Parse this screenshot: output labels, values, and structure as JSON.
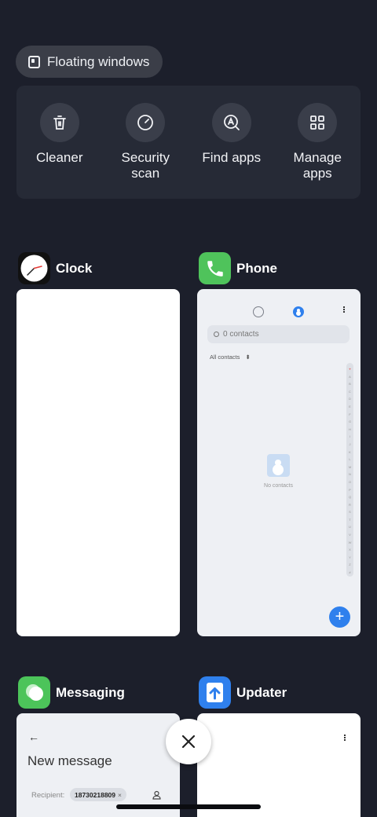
{
  "floating": {
    "label": "Floating windows",
    "icon": "floating-window-icon"
  },
  "tools": [
    {
      "label": "Cleaner",
      "icon": "trash-icon"
    },
    {
      "label": "Security scan",
      "icon": "speedometer-icon"
    },
    {
      "label": "Find apps",
      "icon": "search-apps-icon"
    },
    {
      "label": "Manage apps",
      "icon": "grid-icon"
    }
  ],
  "apps": {
    "clock": {
      "name": "Clock"
    },
    "phone": {
      "name": "Phone",
      "search_placeholder": "0 contacts",
      "filter_label": "All contacts",
      "empty_text": "No contacts",
      "index_letters": [
        "♥",
        "A",
        "B",
        "C",
        "D",
        "E",
        "F",
        "G",
        "H",
        "I",
        "J",
        "K",
        "L",
        "M",
        "N",
        "O",
        "P",
        "Q",
        "R",
        "S",
        "T",
        "U",
        "V",
        "W",
        "X",
        "Y",
        "Z",
        "#"
      ],
      "fab_label": "+"
    },
    "messaging": {
      "name": "Messaging",
      "back": "←",
      "title": "New message",
      "recipient_label": "Recipient:",
      "recipient_value": "18730218809"
    },
    "updater": {
      "name": "Updater"
    }
  },
  "colors": {
    "background": "#1c1f2b",
    "phone_icon": "#4fc35b",
    "messaging_icon": "#4cc45a",
    "updater_icon": "#2f80ed",
    "accent": "#2f80ed"
  }
}
